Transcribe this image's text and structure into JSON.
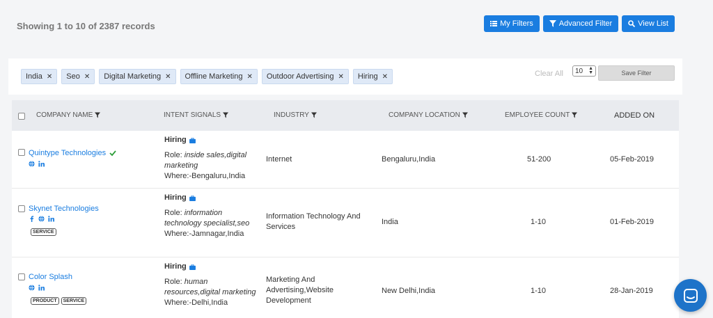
{
  "records_summary": "Showing 1 to 10 of 2387 records",
  "actions": {
    "my_filters": "My Filters",
    "advanced_filter": "Advanced Filter",
    "view_list": "View List"
  },
  "filters": {
    "chips": [
      "India",
      "Seo",
      "Digital Marketing",
      "Offline Marketing",
      "Outdoor Advertising",
      "Hiring"
    ],
    "clear_all": "Clear All",
    "page_size": "10",
    "save_filter": "Save Filter"
  },
  "table": {
    "columns": [
      "COMPANY NAME",
      "INTENT SIGNALS",
      "INDUSTRY",
      "COMPANY LOCATION",
      "EMPLOYEE COUNT",
      "ADDED ON"
    ],
    "rows": [
      {
        "company": "Quintype Technologies",
        "verified": true,
        "social_icons": [
          "globe-icon",
          "linkedin-icon"
        ],
        "tags": [],
        "signal_title": "Hiring",
        "role_label": "Role: ",
        "role": "inside sales,digital marketing",
        "where": "Where:-Bengaluru,India",
        "industry": "Internet",
        "location": "Bengaluru,India",
        "employees": "51-200",
        "added_on": "05-Feb-2019"
      },
      {
        "company": "Skynet Technologies",
        "verified": false,
        "social_icons": [
          "facebook-icon",
          "globe-icon",
          "linkedin-icon"
        ],
        "tags": [
          "SERVICE"
        ],
        "signal_title": "Hiring",
        "role_label": "Role: ",
        "role": "information technology specialist,seo",
        "where": "Where:-Jamnagar,India",
        "industry": "Information Technology And Services",
        "location": "India",
        "employees": "1-10",
        "added_on": "01-Feb-2019"
      },
      {
        "company": "Color Splash",
        "verified": false,
        "social_icons": [
          "globe-icon",
          "linkedin-icon"
        ],
        "tags": [
          "PRODUCT",
          "SERVICE"
        ],
        "signal_title": "Hiring",
        "role_label": "Role: ",
        "role": "human resources,digital marketing",
        "where": "Where:-Delhi,India",
        "industry": "Marketing And Advertising,Website Development",
        "location": "New Delhi,India",
        "employees": "1-10",
        "added_on": "28-Jan-2019"
      }
    ]
  },
  "colors": {
    "accent": "#1a7de0",
    "verified": "#2e9e3a",
    "chip_bg": "#dfe9f7",
    "chat": "#1d73c9"
  }
}
